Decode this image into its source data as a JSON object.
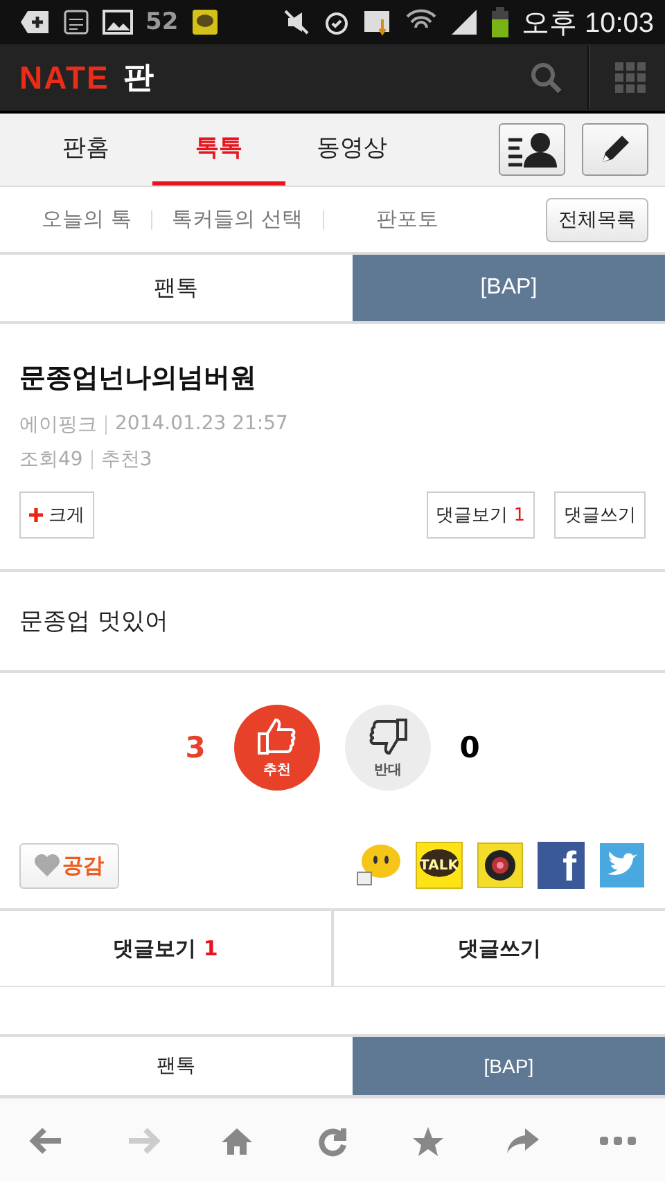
{
  "status_bar": {
    "badge": "52",
    "time": "오후 10:03"
  },
  "header": {
    "logo": "NATE",
    "logo_suffix": "판"
  },
  "tabs": [
    {
      "label": "판홈",
      "selected": false
    },
    {
      "label": "톡톡",
      "selected": true
    },
    {
      "label": "동영상",
      "selected": false
    }
  ],
  "sub_nav": {
    "items": [
      "오늘의 톡",
      "톡커들의 선택",
      "판포토"
    ],
    "all_button": "전체목록"
  },
  "breadcrumb": {
    "section": "팬톡",
    "board": "[BAP]"
  },
  "post": {
    "title": "문종업넌나의넘버원",
    "author": "에이핑크",
    "date": "2014.01.23 21:57",
    "views": "조회49",
    "recommends": "추천3",
    "enlarge": "크게",
    "view_comments": "댓글보기",
    "comment_count": "1",
    "write_comment": "댓글쓰기",
    "body": "문종업 멋있어"
  },
  "vote": {
    "up_count": "3",
    "up_label": "추천",
    "down_label": "반대",
    "down_count": "0"
  },
  "empathy": "공감",
  "share": [
    {
      "kind": "emoticon"
    },
    {
      "kind": "talk",
      "label": "TALK"
    },
    {
      "kind": "camera"
    },
    {
      "kind": "facebook",
      "label": "f"
    },
    {
      "kind": "twitter"
    }
  ],
  "comment_bar": {
    "view": "댓글보기",
    "count": "1",
    "write": "댓글쓰기"
  },
  "breadcrumb_bottom": {
    "section": "팬톡",
    "board": "[BAP]"
  },
  "toolbar": [
    {
      "kind": "back",
      "disabled": false
    },
    {
      "kind": "forward",
      "disabled": true
    },
    {
      "kind": "home",
      "disabled": false
    },
    {
      "kind": "reload",
      "disabled": false
    },
    {
      "kind": "bookmark",
      "disabled": false
    },
    {
      "kind": "share",
      "disabled": false
    },
    {
      "kind": "more",
      "disabled": false
    }
  ]
}
